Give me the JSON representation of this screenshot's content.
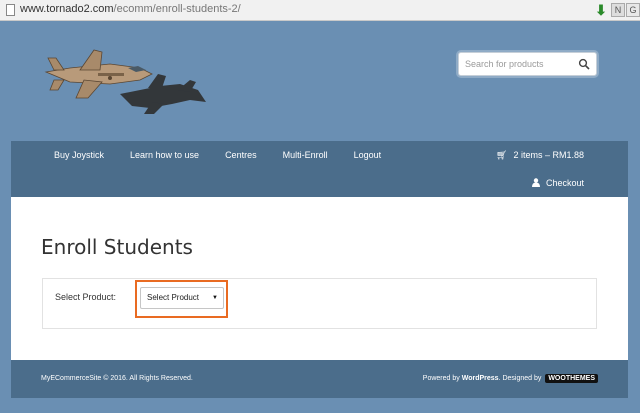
{
  "browser": {
    "url_host": "www.tornado2.com",
    "url_path": "/ecomm/enroll-students-2/"
  },
  "header": {
    "search_placeholder": "Search for products"
  },
  "nav": {
    "items": [
      {
        "label": "Buy Joystick"
      },
      {
        "label": "Learn how to use"
      },
      {
        "label": "Centres"
      },
      {
        "label": "Multi-Enroll"
      },
      {
        "label": "Logout"
      }
    ],
    "cart_label": "2 items – RM1.88",
    "checkout_label": "Checkout"
  },
  "main": {
    "title": "Enroll Students",
    "select_label": "Select Product:",
    "select_value": "Select Product"
  },
  "footer": {
    "copyright": "MyECommerceSite © 2016. All Rights Reserved.",
    "powered_prefix": "Powered by",
    "powered_link": "WordPress",
    "designed_prefix": ". Designed by",
    "designer_logo": "WOOTHEMES"
  },
  "colors": {
    "background": "#6a8fb3",
    "nav": "#4b6d8b",
    "highlight": "#e96b22"
  }
}
